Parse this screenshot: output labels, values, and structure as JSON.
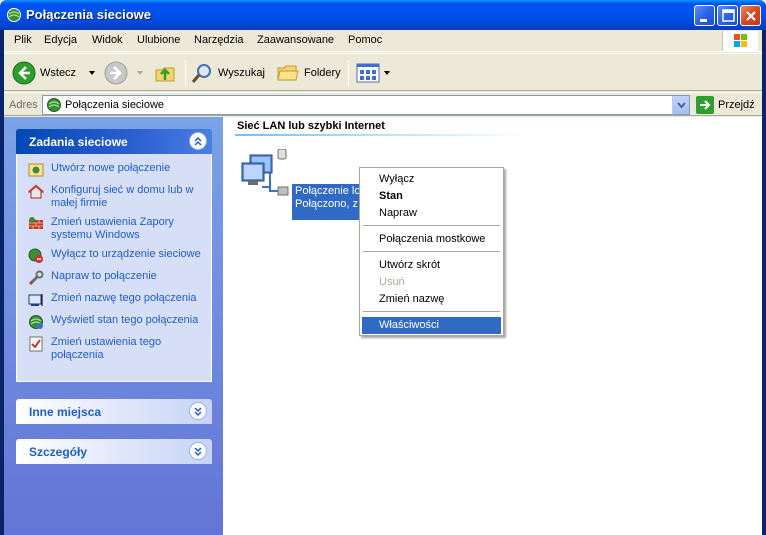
{
  "window": {
    "title": "Połączenia sieciowe",
    "title_icon": "network-connections-icon"
  },
  "menubar": {
    "items": [
      "Plik",
      "Edycja",
      "Widok",
      "Ulubione",
      "Narzędzia",
      "Zaawansowane",
      "Pomoc"
    ]
  },
  "toolbar": {
    "back_label": "Wstecz",
    "search_label": "Wyszukaj",
    "folders_label": "Foldery"
  },
  "address": {
    "label": "Adres",
    "value": "Połączenia sieciowe",
    "go_label": "Przejdź"
  },
  "taskpane": {
    "network_tasks": {
      "title": "Zadania sieciowe",
      "items": [
        {
          "label": "Utwórz nowe połączenie",
          "icon": "new-connection-icon"
        },
        {
          "label": "Konfiguruj sieć w domu lub w małej firmie",
          "icon": "home-network-icon"
        },
        {
          "label": "Zmień ustawienia Zapory systemu Windows",
          "icon": "firewall-icon"
        },
        {
          "label": "Wyłącz to urządzenie sieciowe",
          "icon": "disable-device-icon"
        },
        {
          "label": "Napraw to połączenie",
          "icon": "repair-icon"
        },
        {
          "label": "Zmień nazwę tego połączenia",
          "icon": "rename-icon"
        },
        {
          "label": "Wyświetl stan tego połączenia",
          "icon": "status-icon"
        },
        {
          "label": "Zmień ustawienia tego połączenia",
          "icon": "settings-icon"
        }
      ]
    },
    "other_places": {
      "title": "Inne miejsca"
    },
    "details": {
      "title": "Szczegóły"
    }
  },
  "content": {
    "group_title": "Sieć LAN lub szybki Internet",
    "connection": {
      "name": "Połączenie lokalne",
      "status": "Połączono, z a"
    }
  },
  "context_menu": {
    "items": [
      "Wyłącz",
      "Stan",
      "Napraw",
      "Połączenia mostkowe",
      "Utwórz skrót",
      "Usuń",
      "Zmień nazwę",
      "Właściwości"
    ]
  },
  "colors": {
    "selection": "#316ac5",
    "task_link": "#215dc6",
    "title_bar": "#0053ee"
  }
}
